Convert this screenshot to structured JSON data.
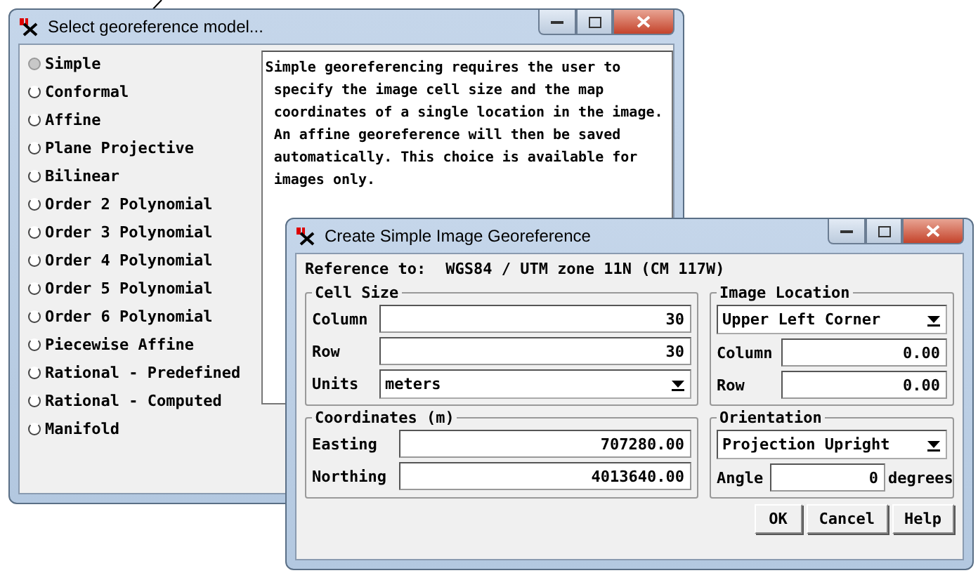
{
  "model_window": {
    "title": "Select georeference model...",
    "models": [
      {
        "label": "Simple",
        "selected": true
      },
      {
        "label": "Conformal",
        "selected": false
      },
      {
        "label": "Affine",
        "selected": false
      },
      {
        "label": "Plane Projective",
        "selected": false
      },
      {
        "label": "Bilinear",
        "selected": false
      },
      {
        "label": "Order 2 Polynomial",
        "selected": false
      },
      {
        "label": "Order 3 Polynomial",
        "selected": false
      },
      {
        "label": "Order 4 Polynomial",
        "selected": false
      },
      {
        "label": "Order 5 Polynomial",
        "selected": false
      },
      {
        "label": "Order 6 Polynomial",
        "selected": false
      },
      {
        "label": "Piecewise Affine",
        "selected": false
      },
      {
        "label": "Rational - Predefined",
        "selected": false
      },
      {
        "label": "Rational - Computed",
        "selected": false
      },
      {
        "label": "Manifold",
        "selected": false
      }
    ],
    "description": "Simple georeferencing requires the user to\n specify the image cell size and the map\n coordinates of a single location in the image.\n An affine georeference will then be saved\n automatically. This choice is available for\n images only."
  },
  "georef_window": {
    "title": "Create Simple Image Georeference",
    "reference_label": "Reference to:",
    "reference_value": "WGS84 / UTM zone 11N (CM 117W)",
    "cell_size": {
      "title": "Cell Size",
      "fields": [
        {
          "kind": "text",
          "label": "Column",
          "value": "30"
        },
        {
          "kind": "text",
          "label": "Row",
          "value": "30"
        },
        {
          "kind": "select",
          "label": "Units",
          "value": "meters"
        }
      ]
    },
    "image_location": {
      "title": "Image Location",
      "fields": [
        {
          "kind": "select",
          "value": "Upper Left Corner"
        },
        {
          "kind": "text",
          "label": "Column",
          "value": "0.00"
        },
        {
          "kind": "text",
          "label": "Row",
          "value": "0.00"
        }
      ]
    },
    "coordinates": {
      "title": "Coordinates (m)",
      "fields": [
        {
          "kind": "text",
          "label": "Easting",
          "value": "707280.00"
        },
        {
          "kind": "text",
          "label": "Northing",
          "value": "4013640.00"
        }
      ]
    },
    "orientation": {
      "title": "Orientation",
      "fields": [
        {
          "kind": "select",
          "value": "Projection Upright"
        },
        {
          "kind": "angle",
          "label": "Angle",
          "value": "0",
          "unit": "degrees"
        }
      ]
    },
    "buttons": [
      "OK",
      "Cancel",
      "Help"
    ]
  }
}
